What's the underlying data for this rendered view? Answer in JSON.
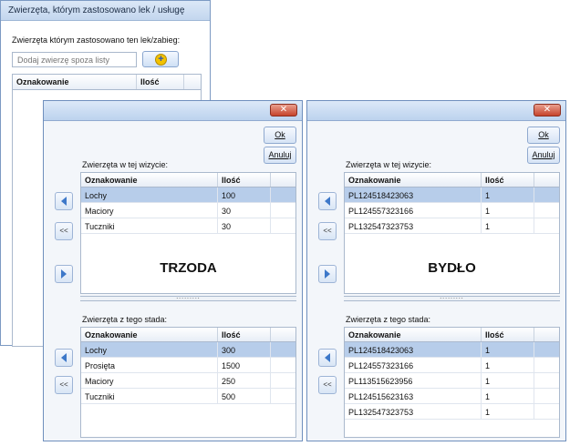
{
  "bg_window": {
    "title": "Zwierzęta, którym zastosowano lek / usługę",
    "label": "Zwierzęta którym zastosowano ten lek/zabieg:",
    "input_placeholder": "Dodaj zwierzę spoza listy",
    "columns": [
      "Oznakowanie",
      "Ilość"
    ]
  },
  "dialogs": [
    {
      "ok_label": "Ok",
      "cancel_label": "Anuluj",
      "visit_label": "Zwierzęta w tej wizycie:",
      "herd_label": "Zwierzęta z tego stada:",
      "columns": [
        "Oznakowanie",
        "Ilość"
      ],
      "big_label": "TRZODA",
      "splitter_grip": ".........",
      "visit_rows": [
        {
          "name": "Lochy",
          "qty": "100",
          "selected": true
        },
        {
          "name": "Maciory",
          "qty": "30",
          "selected": false
        },
        {
          "name": "Tuczniki",
          "qty": "30",
          "selected": false
        }
      ],
      "herd_rows": [
        {
          "name": "Lochy",
          "qty": "300",
          "selected": true
        },
        {
          "name": "Prosięta",
          "qty": "1500",
          "selected": false
        },
        {
          "name": "Maciory",
          "qty": "250",
          "selected": false
        },
        {
          "name": "Tuczniki",
          "qty": "500",
          "selected": false
        }
      ],
      "side_buttons": [
        "<<"
      ]
    },
    {
      "ok_label": "Ok",
      "cancel_label": "Anuluj",
      "visit_label": "Zwierzęta w tej wizycie:",
      "herd_label": "Zwierzęta z tego stada:",
      "columns": [
        "Oznakowanie",
        "Ilość"
      ],
      "big_label": "BYDŁO",
      "splitter_grip": ".........",
      "visit_rows": [
        {
          "name": "PL124518423063",
          "qty": "1",
          "selected": true
        },
        {
          "name": "PL124557323166",
          "qty": "1",
          "selected": false
        },
        {
          "name": "PL132547323753",
          "qty": "1",
          "selected": false
        }
      ],
      "herd_rows": [
        {
          "name": "PL124518423063",
          "qty": "1",
          "selected": true
        },
        {
          "name": "PL124557323166",
          "qty": "1",
          "selected": false
        },
        {
          "name": "PL113515623956",
          "qty": "1",
          "selected": false
        },
        {
          "name": "PL124515623163",
          "qty": "1",
          "selected": false
        },
        {
          "name": "PL132547323753",
          "qty": "1",
          "selected": false
        }
      ],
      "side_buttons": [
        "<<"
      ]
    }
  ],
  "colors": {
    "selection": "#b7cdea",
    "close_button": "#c6432c",
    "window_border": "#6f8fbd"
  }
}
